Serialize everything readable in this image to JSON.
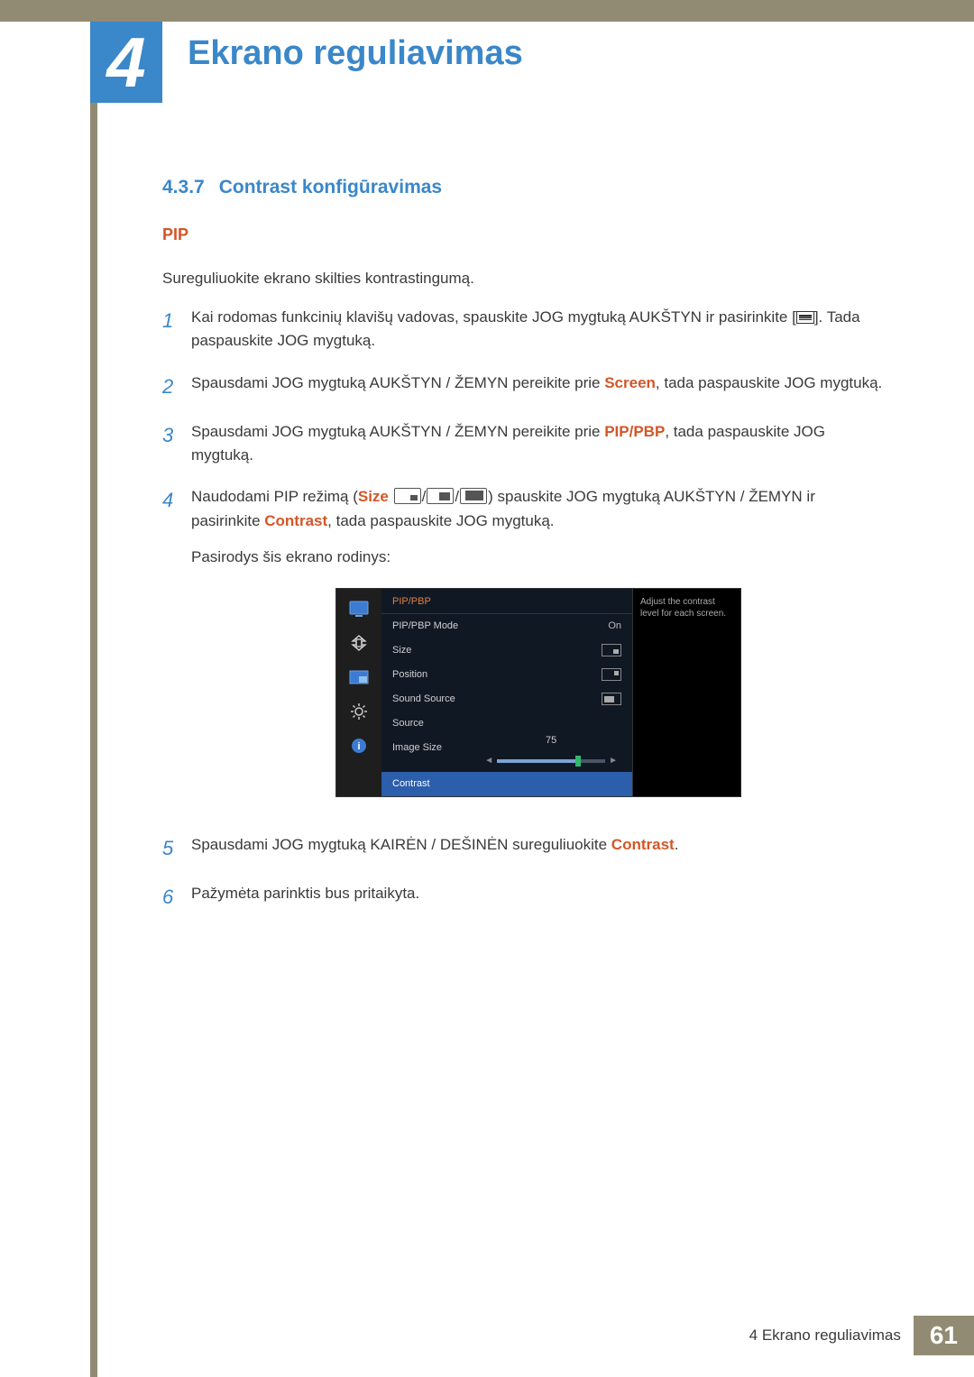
{
  "chapter": {
    "number": "4",
    "title": "Ekrano reguliavimas"
  },
  "section": {
    "number": "4.3.7",
    "title": "Contrast konfigūravimas"
  },
  "subheading": "PIP",
  "intro": "Sureguliuokite ekrano skilties kontrastingumą.",
  "steps": {
    "s1a": "Kai rodomas funkcinių klavišų vadovas, spauskite JOG mygtuką AUKŠTYN ir pasirinkite [",
    "s1b": "]. Tada paspauskite JOG mygtuką.",
    "s2a": "Spausdami JOG mygtuką AUKŠTYN / ŽEMYN pereikite prie ",
    "s2kw": "Screen",
    "s2b": ", tada paspauskite JOG mygtuką.",
    "s3a": "Spausdami JOG mygtuką AUKŠTYN / ŽEMYN pereikite prie ",
    "s3kw": "PIP/PBP",
    "s3b": ", tada paspauskite JOG mygtuką.",
    "s4a": "Naudodami PIP režimą (",
    "s4size": "Size",
    "s4b": ") spauskite JOG mygtuką AUKŠTYN / ŽEMYN ir pasirinkite ",
    "s4kw": "Contrast",
    "s4c": ", tada paspauskite JOG mygtuką.",
    "s4d": "Pasirodys šis ekrano rodinys:",
    "s5a": "Spausdami JOG mygtuką KAIRĖN / DEŠINĖN sureguliuokite ",
    "s5kw": "Contrast",
    "s5b": ".",
    "s6": "Pažymėta parinktis bus pritaikyta."
  },
  "osd": {
    "title": "PIP/PBP",
    "rows": {
      "mode": {
        "label": "PIP/PBP Mode",
        "value": "On"
      },
      "size": {
        "label": "Size"
      },
      "position": {
        "label": "Position"
      },
      "sound": {
        "label": "Sound Source"
      },
      "source": {
        "label": "Source"
      },
      "image": {
        "label": "Image Size"
      },
      "contrast": {
        "label": "Contrast"
      }
    },
    "slider_value": "75",
    "help": "Adjust the contrast level for each screen."
  },
  "footer": {
    "text": "4 Ekrano reguliavimas",
    "page": "61"
  }
}
